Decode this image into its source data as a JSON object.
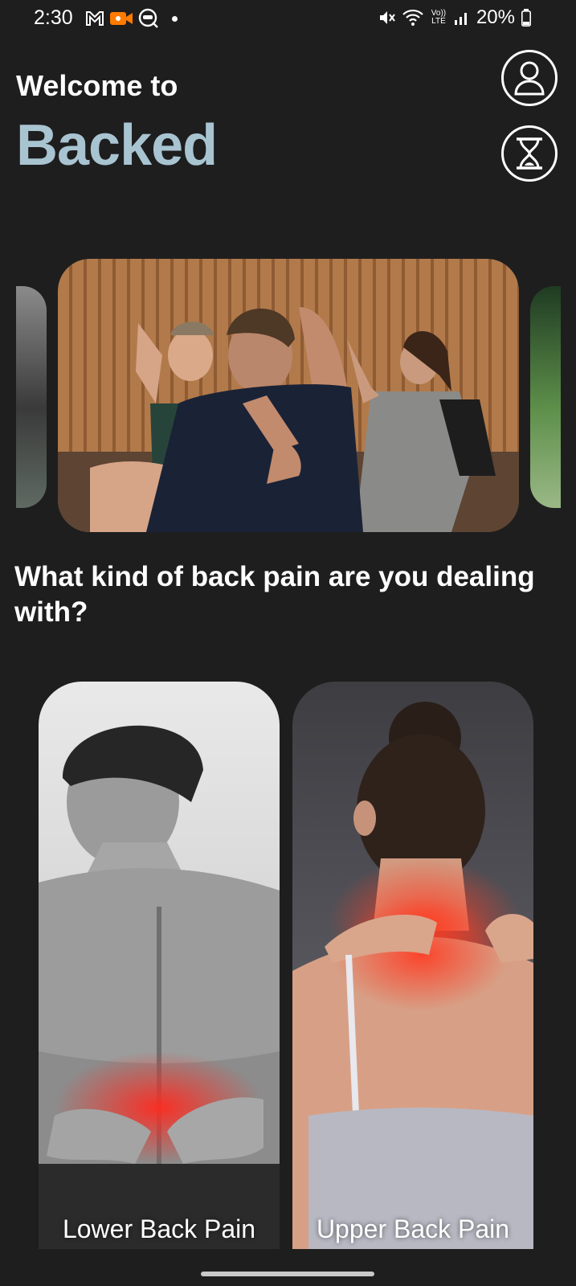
{
  "status_bar": {
    "time": "2:30",
    "battery": "20%",
    "volte": "Vo)) LTE"
  },
  "header": {
    "welcome": "Welcome to",
    "brand": "Backed",
    "brand_color": "#a9c4d1"
  },
  "icons": {
    "profile": "user-icon",
    "history": "hourglass-icon"
  },
  "question": "What kind of back pain are you dealing with?",
  "cards": [
    {
      "label": "Lower Back Pain"
    },
    {
      "label": "Upper Back Pain"
    }
  ]
}
